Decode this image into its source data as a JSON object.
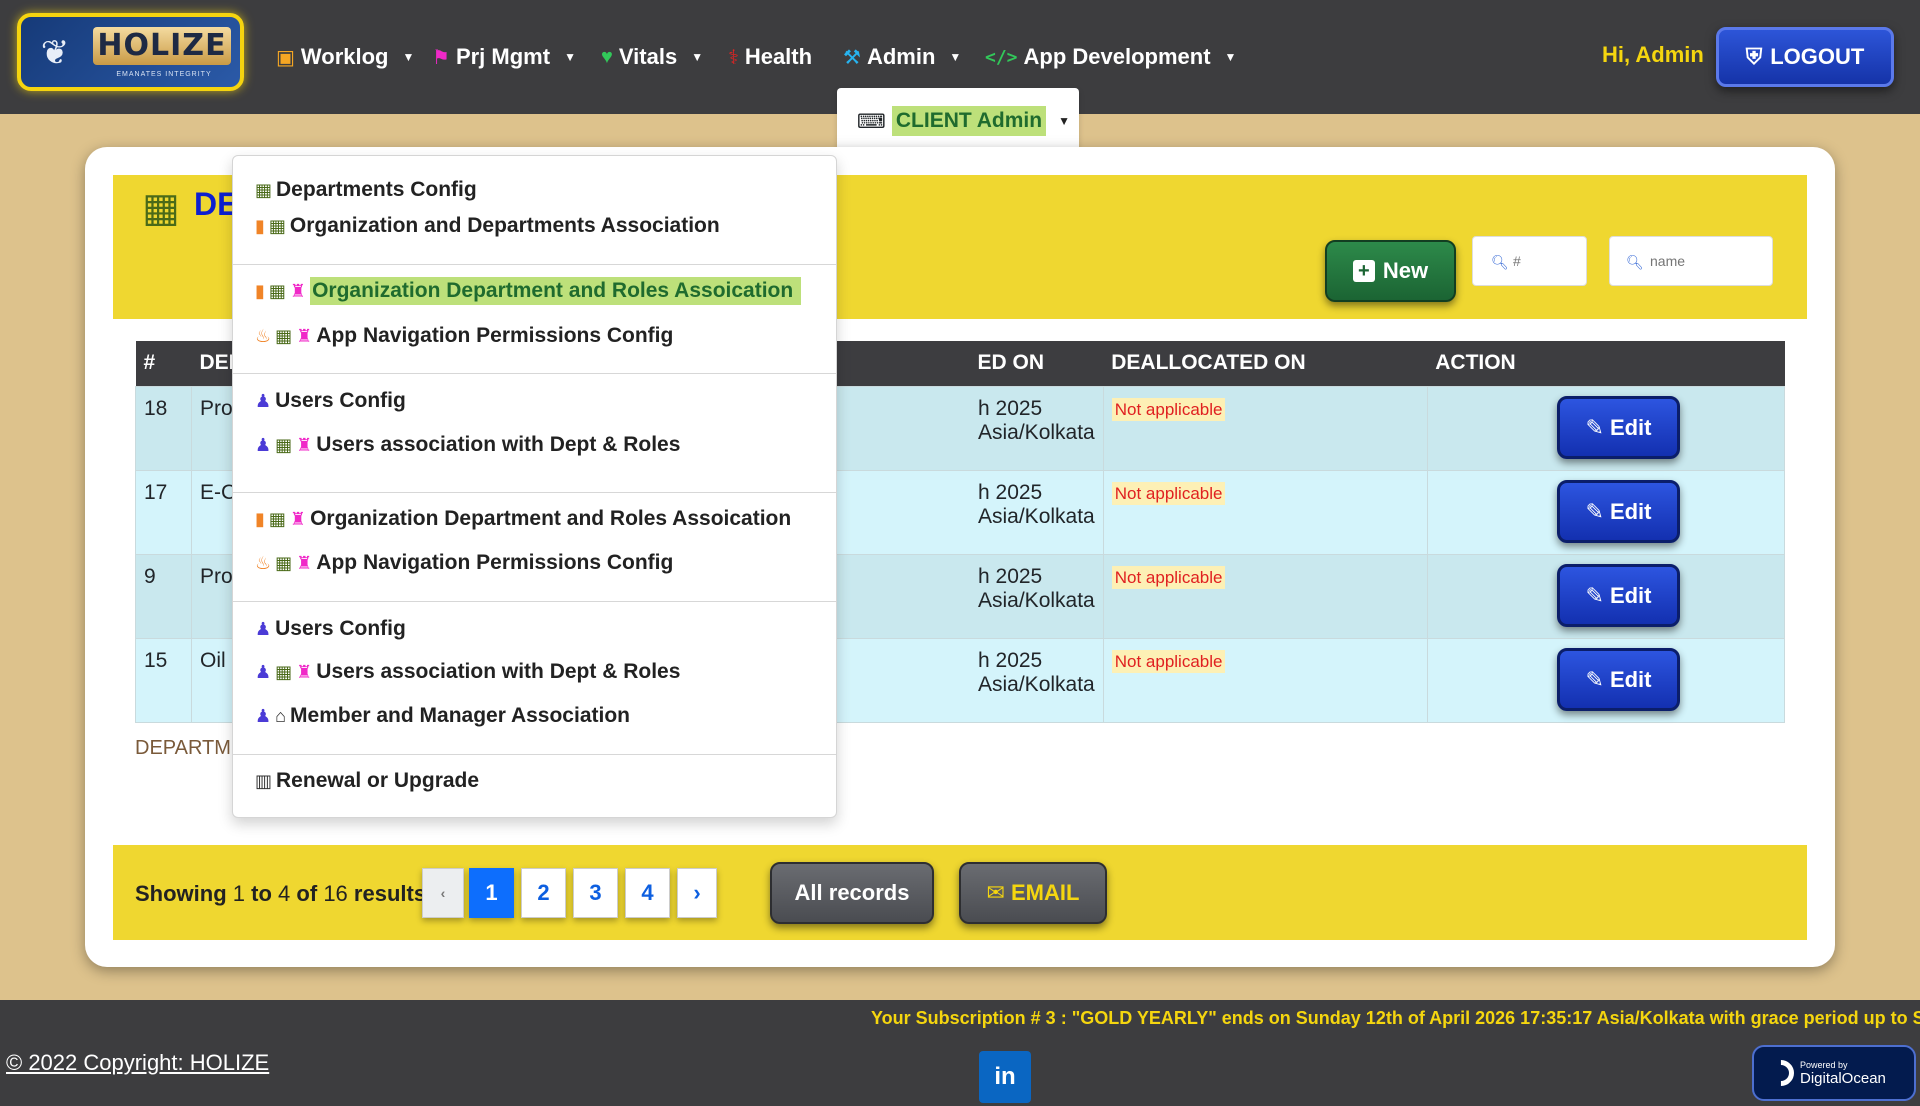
{
  "nav": {
    "brand": "HOLIZE",
    "tagline": "EMANATES INTEGRITY",
    "items": [
      {
        "label": "Worklog",
        "icon": "briefcase-icon",
        "dropdown": true
      },
      {
        "label": "Prj Mgmt",
        "icon": "project-icon",
        "dropdown": true
      },
      {
        "label": "Vitals",
        "icon": "heart-pulse-icon",
        "dropdown": true
      },
      {
        "label": "Health",
        "icon": "stethoscope-icon",
        "dropdown": false
      },
      {
        "label": "Admin",
        "icon": "admin-hammer-icon",
        "dropdown": true
      },
      {
        "label": "App Development",
        "icon": "code-icon",
        "dropdown": true
      }
    ],
    "greeting": "Hi, Admin",
    "logout": "LOGOUT",
    "client_admin": "CLIENT Admin"
  },
  "dropdown": {
    "items": [
      {
        "label": "Departments Config"
      },
      {
        "label": "Organization and Departments Association"
      },
      {
        "label": "Organization Department and Roles Assoication",
        "active": true
      },
      {
        "label": "App Navigation Permissions Config"
      },
      {
        "label": "Users Config"
      },
      {
        "label": "Users association with Dept & Roles"
      },
      {
        "label": "Organization Department and Roles Assoication"
      },
      {
        "label": "App Navigation Permissions Config"
      },
      {
        "label": "Users Config"
      },
      {
        "label": "Users association with Dept & Roles"
      },
      {
        "label": "Member and Manager Association"
      },
      {
        "label": "Renewal or Upgrade"
      }
    ]
  },
  "page": {
    "title": "DE",
    "new_button": "New",
    "search_id_placeholder": "#",
    "search_name_placeholder": "name",
    "footnote": "DEPARTME"
  },
  "table": {
    "headers": [
      "#",
      "DEP",
      "ED ON",
      "DEALLOCATED ON",
      "ACTION"
    ],
    "rows": [
      {
        "id": "18",
        "name": "Pro",
        "allocated": "h 2025 Asia/Kolkata",
        "deallocated": "Not applicable",
        "action": "Edit"
      },
      {
        "id": "17",
        "name": "E-C",
        "allocated": "h 2025 Asia/Kolkata",
        "deallocated": "Not applicable",
        "action": "Edit"
      },
      {
        "id": "9",
        "name": "Pro",
        "allocated": "h 2025 Asia/Kolkata",
        "deallocated": "Not applicable",
        "action": "Edit"
      },
      {
        "id": "15",
        "name": "Oil",
        "allocated": "h 2025 Asia/Kolkata",
        "deallocated": "Not applicable",
        "action": "Edit"
      }
    ]
  },
  "pagination": {
    "showing_prefix": "Showing",
    "from": "1",
    "to_word": "to",
    "to": "4",
    "of_word": "of",
    "total": "16",
    "results_word": "results",
    "prev": "‹",
    "pages": [
      "1",
      "2",
      "3",
      "4"
    ],
    "next": "›",
    "all_records": "All records",
    "email": "EMAIL"
  },
  "footer": {
    "subscription": "Your Subscription # 3 : \"GOLD YEARLY\" ends on Sunday 12th of April 2026 17:35:17 Asia/Kolkata with grace period up to Su",
    "copyright": "© 2022 Copyright: HOLIZE",
    "linkedin": "in",
    "do_small": "Powered by",
    "do_big": "DigitalOcean"
  }
}
